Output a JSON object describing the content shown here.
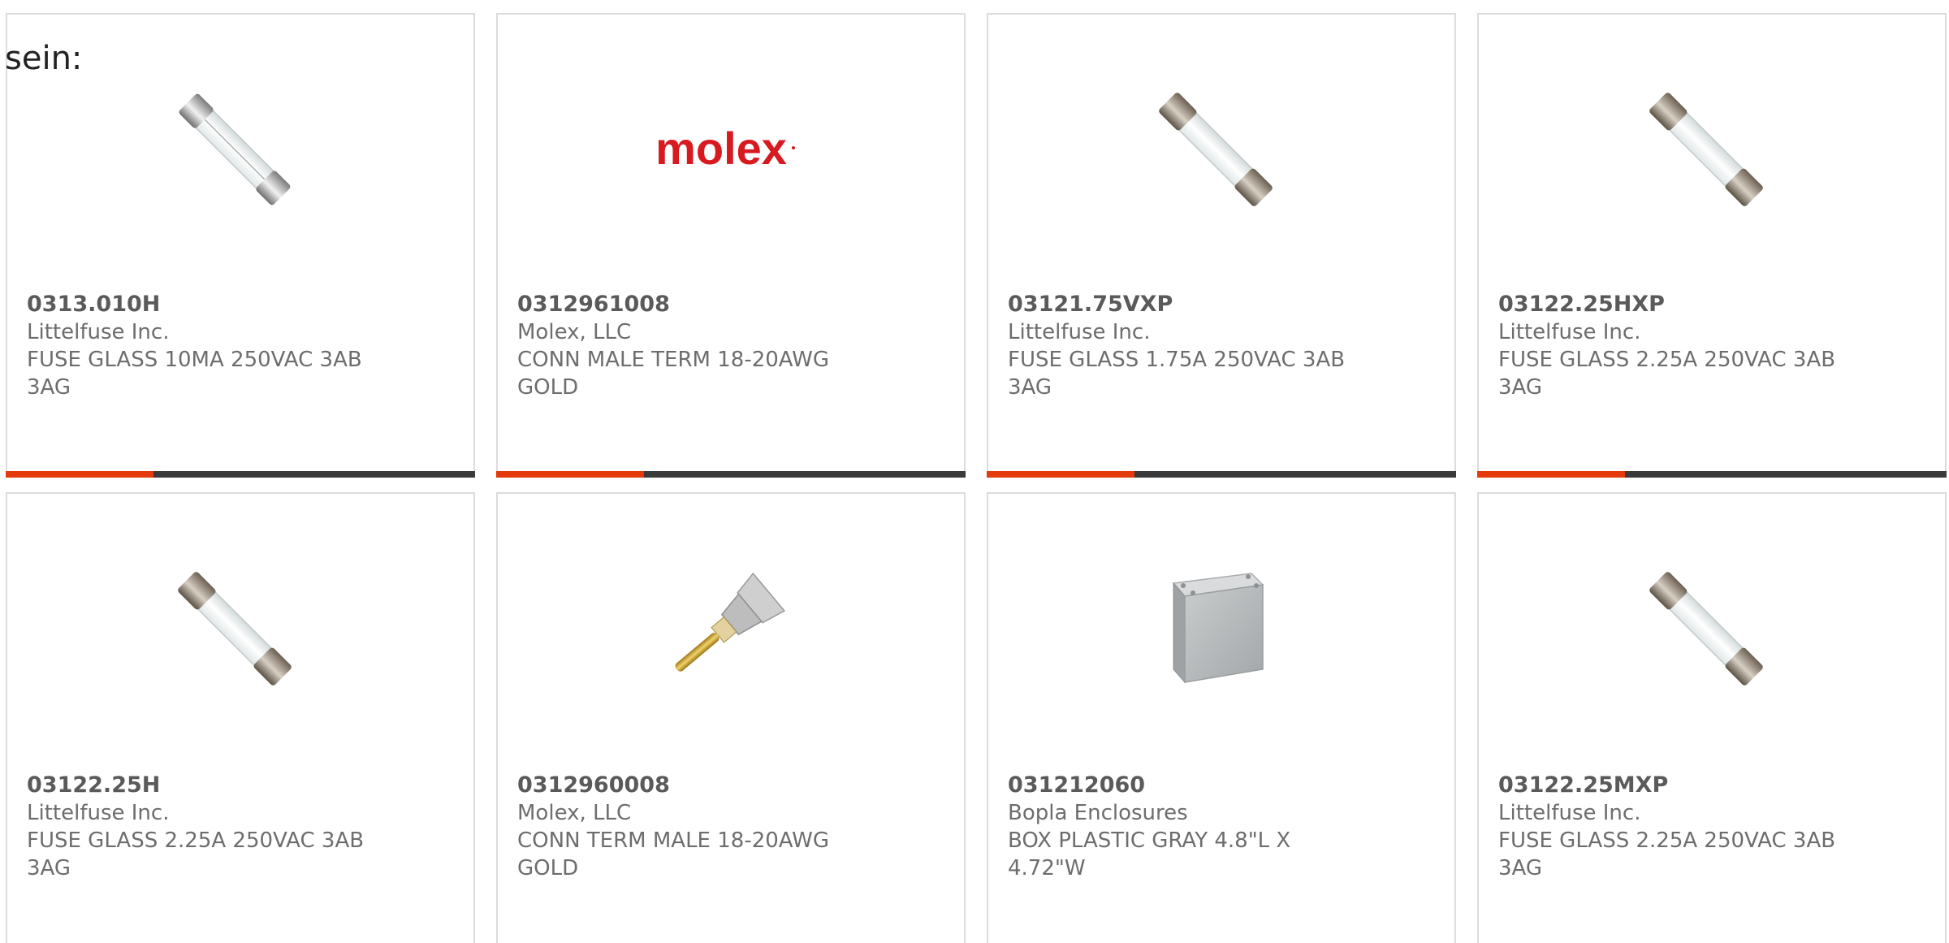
{
  "heading": "sein:",
  "colors": {
    "accent": "#e33b0b",
    "bar": "#3b3b3b",
    "border": "#dcdcdc",
    "text": "#6d6d6d"
  },
  "products": [
    {
      "part_number": "0313.010H",
      "manufacturer": "Littelfuse Inc.",
      "description": "FUSE GLASS 10MA 250VAC 3AB 3AG",
      "image": "glass-fuse-silver-icon"
    },
    {
      "part_number": "0312961008",
      "manufacturer": "Molex, LLC",
      "description": "CONN MALE TERM 18-20AWG GOLD",
      "image": "molex-logo",
      "logo_text": "molex"
    },
    {
      "part_number": "03121.75VXP",
      "manufacturer": "Littelfuse Inc.",
      "description": "FUSE GLASS 1.75A 250VAC 3AB 3AG",
      "image": "glass-fuse-brass-icon"
    },
    {
      "part_number": "03122.25HXP",
      "manufacturer": "Littelfuse Inc.",
      "description": "FUSE GLASS 2.25A 250VAC 3AB 3AG",
      "image": "glass-fuse-brass-icon"
    },
    {
      "part_number": "03122.25H",
      "manufacturer": "Littelfuse Inc.",
      "description": "FUSE GLASS 2.25A 250VAC 3AB 3AG",
      "image": "glass-fuse-brass-icon"
    },
    {
      "part_number": "0312960008",
      "manufacturer": "Molex, LLC",
      "description": "CONN TERM MALE 18-20AWG GOLD",
      "image": "crimp-terminal-icon"
    },
    {
      "part_number": "031212060",
      "manufacturer": "Bopla Enclosures",
      "description": "BOX PLASTIC GRAY 4.8\"L X 4.72\"W",
      "image": "gray-enclosure-box-icon"
    },
    {
      "part_number": "03122.25MXP",
      "manufacturer": "Littelfuse Inc.",
      "description": "FUSE GLASS 2.25A 250VAC 3AB 3AG",
      "image": "glass-fuse-brass-icon"
    }
  ]
}
